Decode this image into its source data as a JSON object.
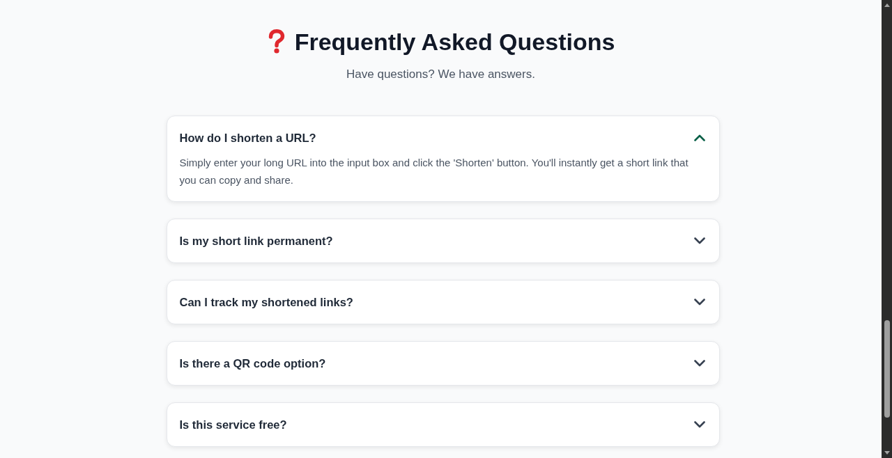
{
  "header": {
    "title": "Frequently Asked Questions",
    "subtitle": "Have questions? We have answers."
  },
  "faqs": [
    {
      "question": "How do I shorten a URL?",
      "expanded": true,
      "answer": "Simply enter your long URL into the input box and click the 'Shorten' button. You'll instantly get a short link that you can copy and share."
    },
    {
      "question": "Is my short link permanent?",
      "expanded": false
    },
    {
      "question": "Can I track my shortened links?",
      "expanded": false
    },
    {
      "question": "Is there a QR code option?",
      "expanded": false
    },
    {
      "question": "Is this service free?",
      "expanded": false
    }
  ]
}
